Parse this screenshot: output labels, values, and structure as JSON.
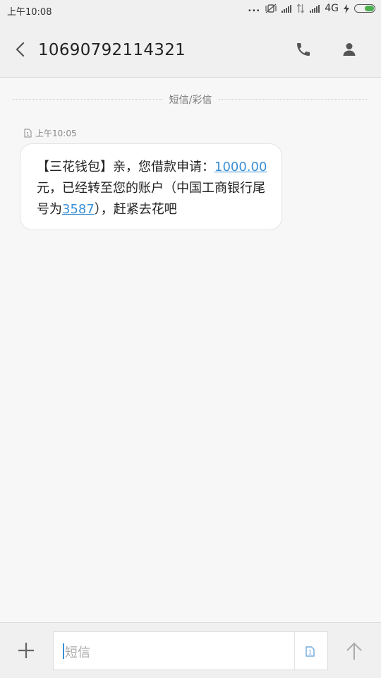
{
  "status_bar": {
    "time": "上午10:08",
    "network": "4G",
    "more": "..."
  },
  "header": {
    "title": "10690792114321"
  },
  "conversation": {
    "channel_label": "短信/彩信",
    "messages": [
      {
        "time": "上午10:05",
        "text_1": "【三花钱包】亲，您借款申请：",
        "amount_link": "1000.00",
        "text_2": "元，已经转至您的账户（中国工商银行尾号为",
        "account_link": "3587",
        "text_3": "），赶紧去花吧"
      }
    ]
  },
  "composer": {
    "placeholder": "短信",
    "sim_slot": "1"
  },
  "colors": {
    "accent": "#3a8fd6",
    "battery": "#4caf50"
  }
}
